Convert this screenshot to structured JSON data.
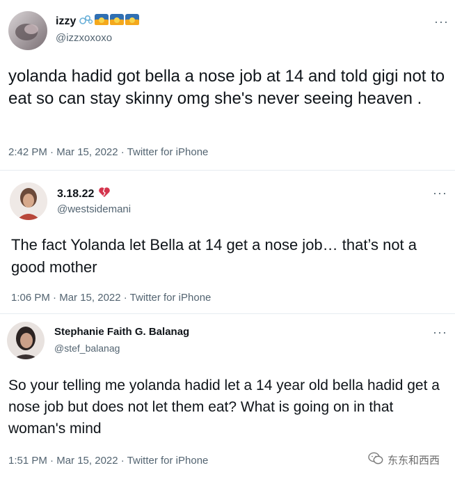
{
  "tweets": [
    {
      "name": "izzy",
      "handle": "@izzxoxoxo",
      "more": "···",
      "text": "yolanda hadid got bella a nose job at 14 and told gigi not to eat so can stay skinny omg she's never seeing heaven .",
      "time": "2:42 PM",
      "date": "Mar 15, 2022",
      "source": "Twitter for iPhone",
      "name_emoji": [
        "bubbles-emoji",
        "sunrise-emoji",
        "sunrise-emoji",
        "sunrise-emoji"
      ]
    },
    {
      "name": "3.18.22",
      "handle": "@westsidemani",
      "more": "···",
      "text": "The fact Yolanda let Bella at 14 get a nose job… that’s not a good mother",
      "time": "1:06 PM",
      "date": "Mar 15, 2022",
      "source": "Twitter for iPhone",
      "name_emoji": [
        "broken-heart-emoji"
      ]
    },
    {
      "name": "Stephanie Faith G. Balanag",
      "handle": "@stef_balanag",
      "more": "···",
      "text": "So your telling me yolanda hadid let a  14 year old bella hadid get a nose job but does not let them eat? What is going on in that woman's mind",
      "time": "1:51 PM",
      "date": "Mar 15, 2022",
      "source": "Twitter for iPhone"
    }
  ],
  "meta_separator": " · ",
  "watermark": "东东和西西"
}
